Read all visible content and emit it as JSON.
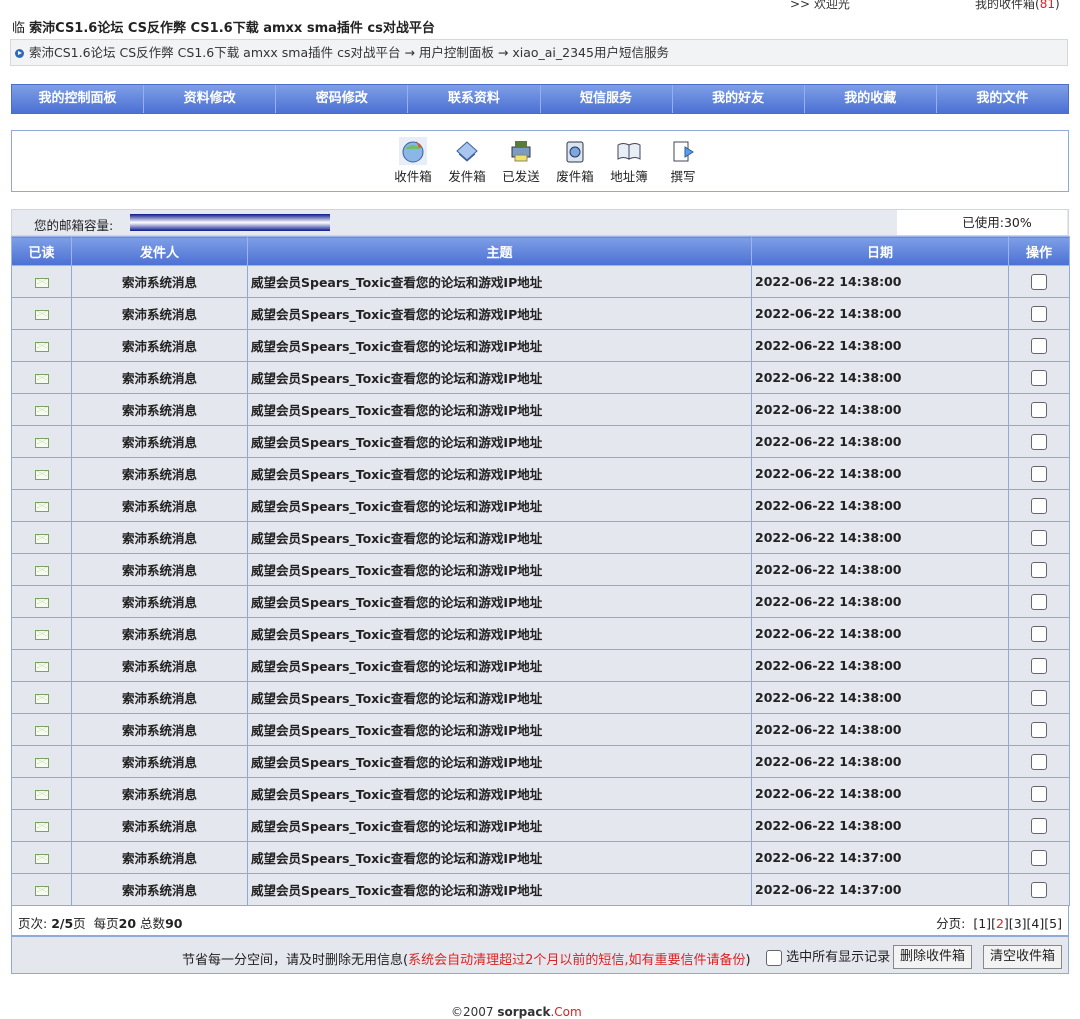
{
  "topbar": {
    "welcome": ">> 欢迎光",
    "inbox_label": "我的收件箱",
    "inbox_count": "81"
  },
  "title": {
    "prefix": "临",
    "site_name": "索沛CS1.6论坛 CS反作弊 CS1.6下载 amxx sma插件 cs对战平台"
  },
  "breadcrumb": {
    "site": "索沛CS1.6论坛 CS反作弊 CS1.6下载 amxx sma插件 cs对战平台",
    "sep1": " → ",
    "panel": "用户控制面板",
    "sep2": " → ",
    "page": "xiao_ai_2345用户短信服务"
  },
  "nav": [
    "我的控制面板",
    "资料修改",
    "密码修改",
    "联系资料",
    "短信服务",
    "我的好友",
    "我的收藏",
    "我的文件"
  ],
  "tools": [
    {
      "label": "收件箱",
      "icon": "inbox-icon"
    },
    {
      "label": "发件箱",
      "icon": "outbox-icon"
    },
    {
      "label": "已发送",
      "icon": "sent-icon"
    },
    {
      "label": "废件箱",
      "icon": "trash-icon"
    },
    {
      "label": "地址簿",
      "icon": "address-book-icon"
    },
    {
      "label": "撰写",
      "icon": "compose-icon"
    }
  ],
  "quota": {
    "label": "您的邮箱容量:",
    "used_text": "已使用:30%",
    "used_fraction": 0.3
  },
  "table": {
    "headers": {
      "read": "已读",
      "sender": "发件人",
      "subject": "主题",
      "date": "日期",
      "op": "操作"
    },
    "rows": [
      {
        "sender": "索沛系统消息",
        "subject": "威望会员Spears_Toxic查看您的论坛和游戏IP地址",
        "date": "2022-06-22 14:38:00"
      },
      {
        "sender": "索沛系统消息",
        "subject": "威望会员Spears_Toxic查看您的论坛和游戏IP地址",
        "date": "2022-06-22 14:38:00"
      },
      {
        "sender": "索沛系统消息",
        "subject": "威望会员Spears_Toxic查看您的论坛和游戏IP地址",
        "date": "2022-06-22 14:38:00"
      },
      {
        "sender": "索沛系统消息",
        "subject": "威望会员Spears_Toxic查看您的论坛和游戏IP地址",
        "date": "2022-06-22 14:38:00"
      },
      {
        "sender": "索沛系统消息",
        "subject": "威望会员Spears_Toxic查看您的论坛和游戏IP地址",
        "date": "2022-06-22 14:38:00"
      },
      {
        "sender": "索沛系统消息",
        "subject": "威望会员Spears_Toxic查看您的论坛和游戏IP地址",
        "date": "2022-06-22 14:38:00"
      },
      {
        "sender": "索沛系统消息",
        "subject": "威望会员Spears_Toxic查看您的论坛和游戏IP地址",
        "date": "2022-06-22 14:38:00"
      },
      {
        "sender": "索沛系统消息",
        "subject": "威望会员Spears_Toxic查看您的论坛和游戏IP地址",
        "date": "2022-06-22 14:38:00"
      },
      {
        "sender": "索沛系统消息",
        "subject": "威望会员Spears_Toxic查看您的论坛和游戏IP地址",
        "date": "2022-06-22 14:38:00"
      },
      {
        "sender": "索沛系统消息",
        "subject": "威望会员Spears_Toxic查看您的论坛和游戏IP地址",
        "date": "2022-06-22 14:38:00"
      },
      {
        "sender": "索沛系统消息",
        "subject": "威望会员Spears_Toxic查看您的论坛和游戏IP地址",
        "date": "2022-06-22 14:38:00"
      },
      {
        "sender": "索沛系统消息",
        "subject": "威望会员Spears_Toxic查看您的论坛和游戏IP地址",
        "date": "2022-06-22 14:38:00"
      },
      {
        "sender": "索沛系统消息",
        "subject": "威望会员Spears_Toxic查看您的论坛和游戏IP地址",
        "date": "2022-06-22 14:38:00"
      },
      {
        "sender": "索沛系统消息",
        "subject": "威望会员Spears_Toxic查看您的论坛和游戏IP地址",
        "date": "2022-06-22 14:38:00"
      },
      {
        "sender": "索沛系统消息",
        "subject": "威望会员Spears_Toxic查看您的论坛和游戏IP地址",
        "date": "2022-06-22 14:38:00"
      },
      {
        "sender": "索沛系统消息",
        "subject": "威望会员Spears_Toxic查看您的论坛和游戏IP地址",
        "date": "2022-06-22 14:38:00"
      },
      {
        "sender": "索沛系统消息",
        "subject": "威望会员Spears_Toxic查看您的论坛和游戏IP地址",
        "date": "2022-06-22 14:38:00"
      },
      {
        "sender": "索沛系统消息",
        "subject": "威望会员Spears_Toxic查看您的论坛和游戏IP地址",
        "date": "2022-06-22 14:38:00"
      },
      {
        "sender": "索沛系统消息",
        "subject": "威望会员Spears_Toxic查看您的论坛和游戏IP地址",
        "date": "2022-06-22 14:37:00"
      },
      {
        "sender": "索沛系统消息",
        "subject": "威望会员Spears_Toxic查看您的论坛和游戏IP地址",
        "date": "2022-06-22 14:37:00"
      }
    ]
  },
  "pager": {
    "pages_label": "页次:",
    "current": "2/5",
    "pages_suffix": "页",
    "per_page_label": "每页",
    "per_page": "20",
    "total_label": "总数",
    "total": "90",
    "nav_label": "分页:",
    "pages": [
      "1",
      "2",
      "3",
      "4",
      "5"
    ],
    "current_page": "2"
  },
  "footer": {
    "note": "节省每一分空间，请及时删除无用信息(",
    "note_red": "系统会自动清理超过2个月以前的短信,如有重要信件请备份",
    "note_end": ")",
    "select_all": "选中所有显示记录",
    "delete_btn": "删除收件箱",
    "clear_btn": "清空收件箱"
  },
  "copyright": {
    "prefix": "©2007 ",
    "brand": "sorpack",
    "suffix": ".Com"
  },
  "colors": {
    "nav_top": "#7e9fe6",
    "nav_bottom": "#4c70d4",
    "row_bg": "#e5e7ef",
    "border": "#8fa9d8",
    "alert_red": "#d22222"
  }
}
